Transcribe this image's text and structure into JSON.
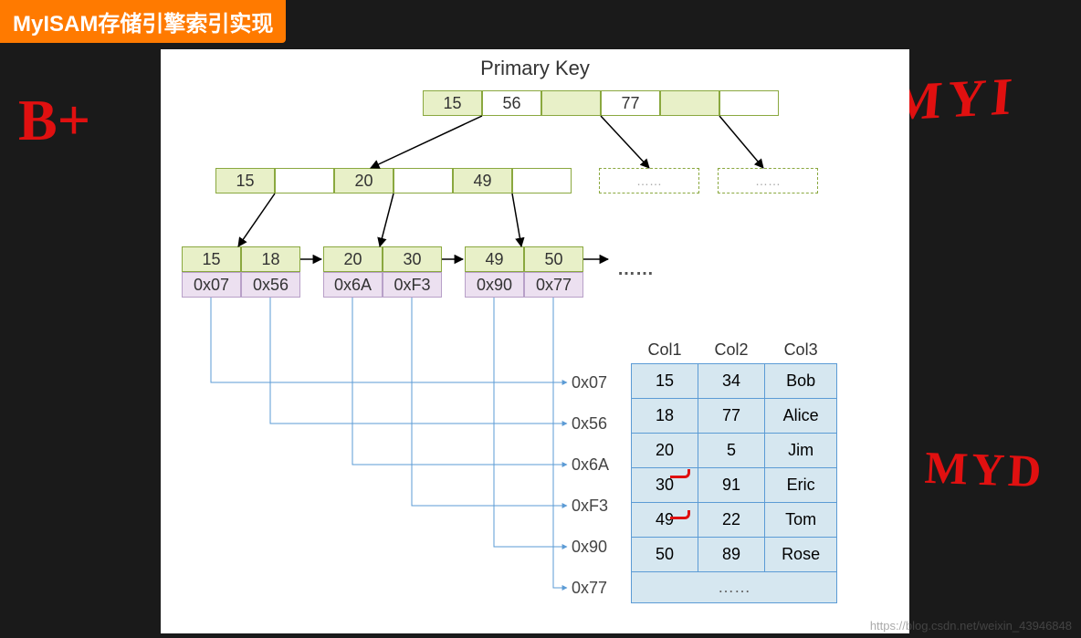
{
  "title": "MyISAM存储引擎索引实现",
  "section_title": "Primary Key",
  "root": [
    "15",
    "56",
    "",
    "77",
    ""
  ],
  "mid": [
    "15",
    "",
    "20",
    "",
    "49",
    ""
  ],
  "leaf_keys": [
    "15",
    "18",
    "20",
    "30",
    "49",
    "50"
  ],
  "leaf_addrs": [
    "0x07",
    "0x56",
    "0x6A",
    "0xF3",
    "0x90",
    "0x77"
  ],
  "leaf_dots": "……",
  "ghost_dots": "……",
  "addr_labels": [
    "0x07",
    "0x56",
    "0x6A",
    "0xF3",
    "0x90",
    "0x77"
  ],
  "table": {
    "headers": [
      "Col1",
      "Col2",
      "Col3"
    ],
    "rows": [
      [
        "15",
        "34",
        "Bob"
      ],
      [
        "18",
        "77",
        "Alice"
      ],
      [
        "20",
        "5",
        "Jim"
      ],
      [
        "30",
        "91",
        "Eric"
      ],
      [
        "49",
        "22",
        "Tom"
      ],
      [
        "50",
        "89",
        "Rose"
      ]
    ],
    "ellipsis": "……"
  },
  "annotations": {
    "bplus": "B+",
    "myi": "MYI",
    "myd": "MYD"
  },
  "watermark": "https://blog.csdn.net/weixin_43946848"
}
